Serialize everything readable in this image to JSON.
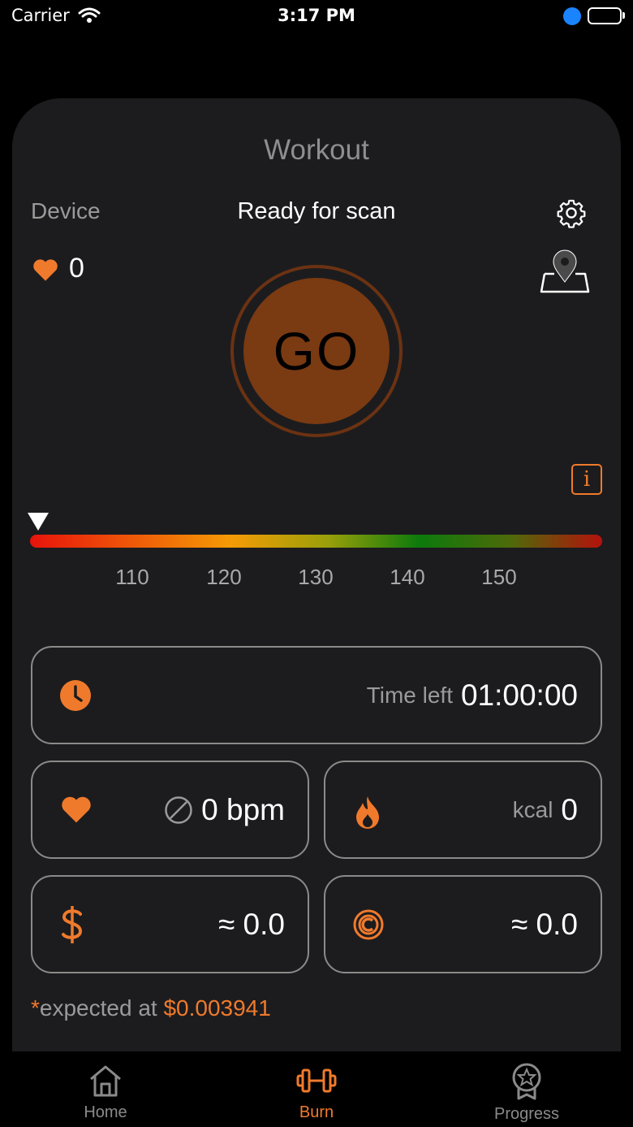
{
  "status_bar": {
    "carrier": "Carrier",
    "time": "3:17 PM"
  },
  "header": {
    "title": "Workout",
    "device_label": "Device",
    "scan_status": "Ready for scan"
  },
  "heart_rate_live": "0",
  "go_button": {
    "label": "GO"
  },
  "info_button": {
    "label": "i"
  },
  "zones": {
    "ticks": [
      "110",
      "120",
      "130",
      "140",
      "150"
    ]
  },
  "stats": {
    "time_left_label": "Time left",
    "time_left_value": "01:00:00",
    "avg_hr_value": "0 bpm",
    "kcal_label": "kcal",
    "kcal_value": "0",
    "usd_value": "≈ 0.0",
    "coin_value": "≈ 0.0"
  },
  "footnote": {
    "asterisk": "*",
    "text": "expected at ",
    "price": "$0.003941"
  },
  "tabs": [
    {
      "label": "Home",
      "icon": "home-icon",
      "active": false
    },
    {
      "label": "Burn",
      "icon": "dumbbell-icon",
      "active": true
    },
    {
      "label": "Progress",
      "icon": "award-icon",
      "active": false
    }
  ],
  "colors": {
    "accent": "#f07a2c",
    "card": "#1c1c1e",
    "go": "#7a3a12"
  }
}
